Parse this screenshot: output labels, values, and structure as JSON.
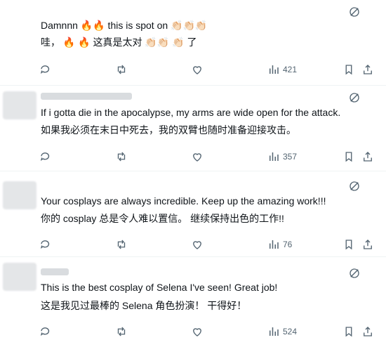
{
  "replies": [
    {
      "text_en": "Damnnn 🔥🔥 this is spot on 👏🏻👏🏻👏🏻",
      "text_zh": "哇， 🔥 🔥 这真是太对 👏🏻👏🏻 👏🏻 了",
      "views": "421"
    },
    {
      "text_en": "If i gotta die in the apocalypse, my arms are wide open for the attack.",
      "text_zh": "如果我必须在末日中死去，我的双臂也随时准备迎接攻击。",
      "views": "357"
    },
    {
      "text_en": "Your cosplays are always incredible.  Keep up the amazing work!!!",
      "text_zh": "你的 cosplay 总是令人难以置信。 继续保持出色的工作!!",
      "views": "76"
    },
    {
      "text_en": "This is the best cosplay of Selena I've seen!  Great job!",
      "text_zh": "这是我见过最棒的 Selena 角色扮演！ 干得好！",
      "views": "524"
    }
  ],
  "icons": {
    "reply": "reply-icon",
    "retweet": "retweet-icon",
    "like": "like-icon",
    "views": "views-icon",
    "bookmark": "bookmark-icon",
    "share": "share-icon",
    "translate": "translate-icon"
  },
  "colors": {
    "icon": "#536471",
    "divider": "#eff3f4"
  }
}
